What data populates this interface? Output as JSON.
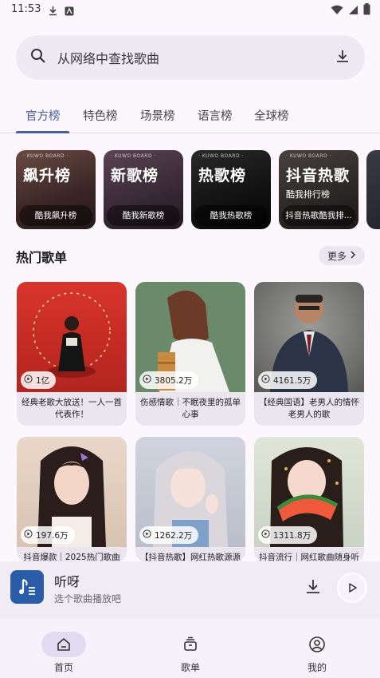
{
  "status_bar": {
    "time": "11:53"
  },
  "search": {
    "placeholder": "从网络中查找歌曲"
  },
  "tabs": [
    {
      "label": "官方榜"
    },
    {
      "label": "特色榜"
    },
    {
      "label": "场景榜"
    },
    {
      "label": "语言榜"
    },
    {
      "label": "全球榜"
    }
  ],
  "rank_cards": [
    {
      "tagline": "· KUWO BOARD ·",
      "big_text": "飙升榜",
      "sub_text": "",
      "caption": "酷我飙升榜"
    },
    {
      "tagline": "· KUWO BOARD ·",
      "big_text": "新歌榜",
      "sub_text": "",
      "caption": "酷我新歌榜"
    },
    {
      "tagline": "· KUWO BOARD ·",
      "big_text": "热歌榜",
      "sub_text": "",
      "caption": "酷我热歌榜"
    },
    {
      "tagline": "· KUWO BOARD ·",
      "big_text": "抖音热歌",
      "sub_text": "酷我排行榜",
      "caption": "抖音热歌酷我排..."
    }
  ],
  "section": {
    "title": "热门歌单",
    "more_label": "更多"
  },
  "playlists": [
    {
      "count": "1亿",
      "title": "经典老歌大放送！一人一首代表作！"
    },
    {
      "count": "3805.2万",
      "title": "伤感情歌｜不眠夜里的孤单心事"
    },
    {
      "count": "4161.5万",
      "title": "【经典国语】老男人的情怀老男人的歌"
    },
    {
      "count": "197.6万",
      "title": "抖音爆款｜2025热门歌曲"
    },
    {
      "count": "1262.2万",
      "title": "【抖音热歌】网红热歌源源"
    },
    {
      "count": "1311.8万",
      "title": "抖音流行｜网红歌曲随身听"
    }
  ],
  "mini_player": {
    "title": "听呀",
    "subtitle": "选个歌曲播放吧"
  },
  "bottom_nav": [
    {
      "label": "首页"
    },
    {
      "label": "歌单"
    },
    {
      "label": "我的"
    }
  ],
  "colors": {
    "accent": "#4b5b9e",
    "background": "#fbf7fc",
    "search_bg": "#efe9f2",
    "nav_active": "#e2dbf2"
  }
}
